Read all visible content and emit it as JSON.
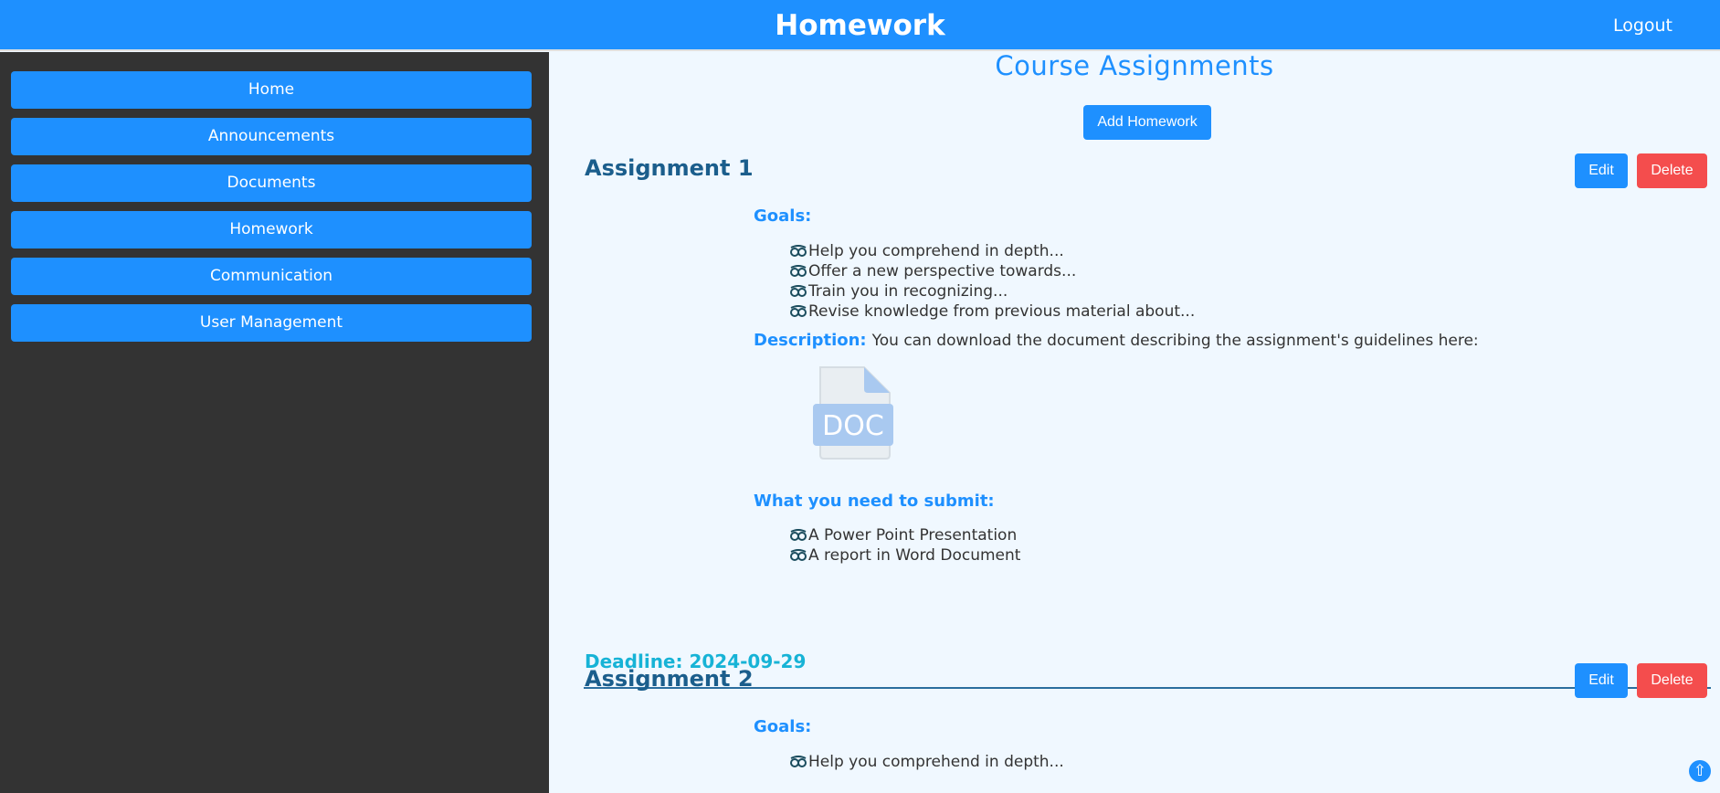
{
  "header": {
    "title": "Homework",
    "logout": "Logout"
  },
  "sidebar": {
    "items": [
      {
        "label": "Home"
      },
      {
        "label": "Announcements"
      },
      {
        "label": "Documents"
      },
      {
        "label": "Homework"
      },
      {
        "label": "Communication"
      },
      {
        "label": "User Management"
      }
    ]
  },
  "main": {
    "title": "Course Assignments",
    "add_button": "Add Homework",
    "assignments": [
      {
        "title": "Assignment 1",
        "edit": "Edit",
        "delete": "Delete",
        "goals_label": "Goals:",
        "goals": [
          "Help you comprehend in depth...",
          "Offer a new perspective towards...",
          "Train you in recognizing...",
          "Revise knowledge from previous material about..."
        ],
        "description_label": "Description:",
        "description_text": "You can download the document describing the assignment's guidelines here:",
        "doc_icon_text": "DOC",
        "submit_label": "What you need to submit:",
        "submit_items": [
          "A Power Point Presentation",
          "A report in Word Document"
        ],
        "deadline": "Deadline: 2024-09-29"
      },
      {
        "title": "Assignment 2",
        "edit": "Edit",
        "delete": "Delete",
        "goals_label": "Goals:",
        "goals": [
          "Help you comprehend in depth..."
        ]
      }
    ]
  },
  "icons": {
    "bullet": "glasses-icon",
    "doc": "doc-file-icon",
    "scroll_top": "arrow-up-icon"
  },
  "colors": {
    "primary": "#1e90ff",
    "danger": "#f44d4d",
    "sidebar_bg": "#333333",
    "main_bg": "#f0f8ff",
    "assignment_title": "#1b5e8c",
    "deadline": "#17b3d6"
  }
}
